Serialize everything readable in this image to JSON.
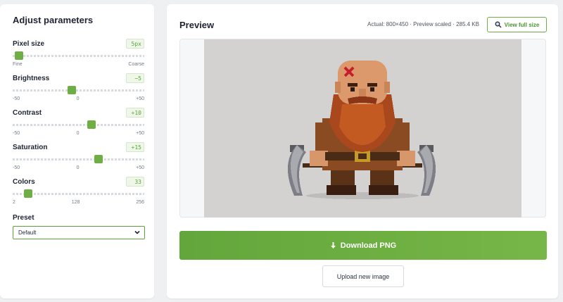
{
  "left_panel": {
    "title": "Adjust parameters",
    "params": [
      {
        "label": "Pixel size",
        "value": "5px",
        "scale": [
          "Fine",
          "",
          "Coarse"
        ],
        "level": 0.05
      },
      {
        "label": "Brightness",
        "value": "−5",
        "scale": [
          "-50",
          "0",
          "+50"
        ],
        "level": 0.45
      },
      {
        "label": "Contrast",
        "value": "+10",
        "scale": [
          "-50",
          "0",
          "+50"
        ],
        "level": 0.6
      },
      {
        "label": "Saturation",
        "value": "+15",
        "scale": [
          "-50",
          "0",
          "+50"
        ],
        "level": 0.65
      },
      {
        "label": "Colors",
        "value": "33",
        "scale": [
          "2",
          "128",
          "256"
        ],
        "level": 0.12
      }
    ],
    "preset_label": "Preset",
    "preset_value": "Default"
  },
  "right_panel": {
    "title": "Preview",
    "meta": "Actual: 800×450 · Preview scaled · 285.4 KB",
    "view_full_label": "View full size",
    "download_label": "Download PNG",
    "upload_label": "Upload new image"
  },
  "colors": {
    "accent": "#6fad45",
    "accent_dark": "#4e9434",
    "canvas_bg": "#d3d2d0"
  },
  "icons": {
    "view": "magnifier-icon",
    "download": "download-arrow-icon",
    "select": "chevron-down-icon"
  }
}
